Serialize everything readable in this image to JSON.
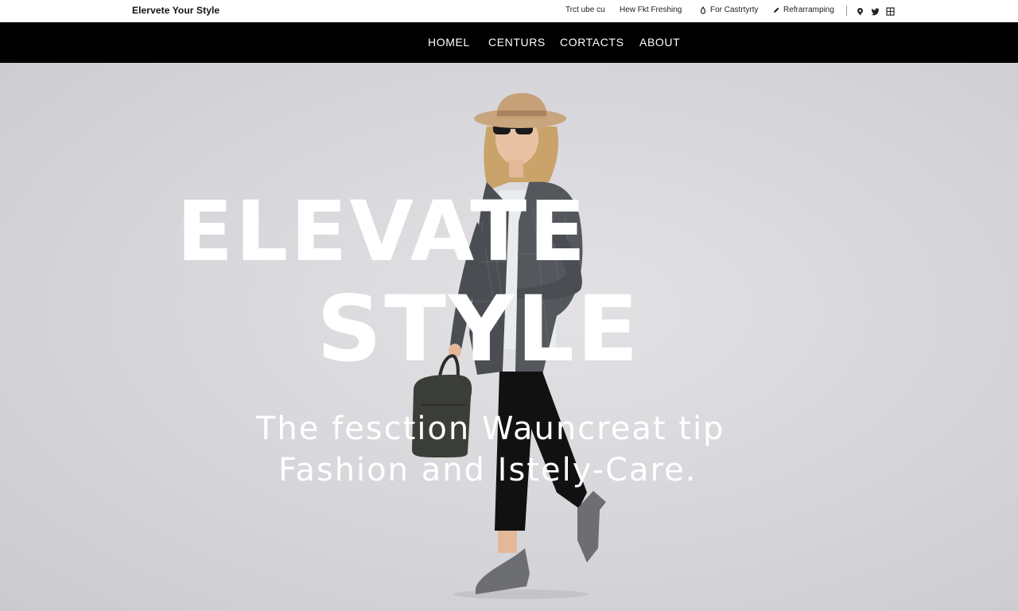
{
  "topbar": {
    "brand": "Elervete Your Style",
    "links": [
      {
        "label": "Trct ube cu",
        "icon": ""
      },
      {
        "label": "Hew Fkt Freshing",
        "icon": ""
      },
      {
        "label": "For Castrtyrty",
        "icon": "drop-icon"
      },
      {
        "label": "Refrarramping",
        "icon": "pencil-icon"
      }
    ],
    "social": [
      "pin-icon",
      "twitter-icon",
      "grid-icon"
    ]
  },
  "nav": {
    "items": [
      "HOMEL",
      "CENTURS",
      "CORTACTS",
      "ABOUT"
    ]
  },
  "hero": {
    "headline_line1": "ELEVATE",
    "headline_line2": "STYLE",
    "subtitle_line1": "The fesction Wauncreat tip",
    "subtitle_line2": "Fashion and Istely-Care."
  },
  "colors": {
    "navbar_bg": "#000000",
    "hero_bg": "#d6d5d9",
    "hero_text": "#ffffff"
  }
}
